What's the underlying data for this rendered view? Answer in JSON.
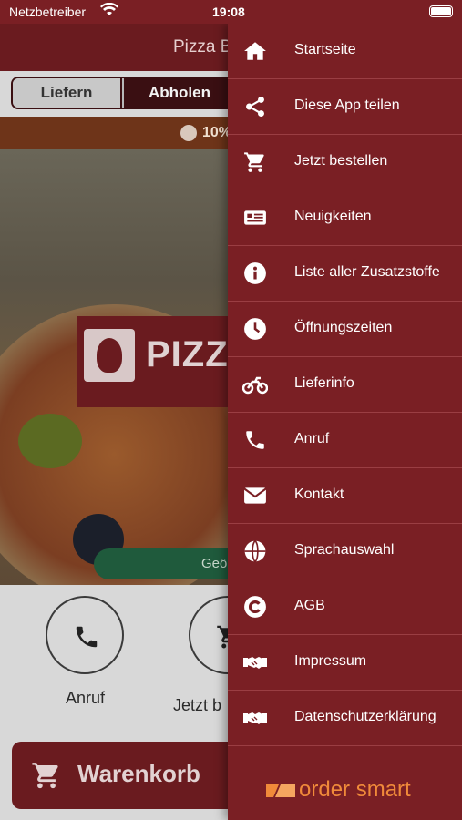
{
  "status_bar": {
    "carrier": "Netzbetreiber",
    "time": "19:08"
  },
  "header": {
    "title": "Pizza B"
  },
  "delivery_mode": {
    "options": [
      "Liefern",
      "Abholen"
    ],
    "selected": "Abholen"
  },
  "promo": {
    "text": "10%"
  },
  "hero": {
    "logo_text": "PIZZA",
    "open_status": "Geö"
  },
  "actions": [
    {
      "label": "Anruf",
      "icon": "phone-icon"
    },
    {
      "label": "Jetzt b",
      "icon": "cart-icon"
    }
  ],
  "cart": {
    "label": "Warenkorb"
  },
  "menu": {
    "items": [
      {
        "label": "Startseite",
        "icon": "home-icon"
      },
      {
        "label": "Diese App teilen",
        "icon": "share-icon"
      },
      {
        "label": "Jetzt bestellen",
        "icon": "cart-icon"
      },
      {
        "label": "Neuigkeiten",
        "icon": "newspaper-icon"
      },
      {
        "label": "Liste aller Zusatzstoffe",
        "icon": "info-icon"
      },
      {
        "label": "Öffnungszeiten",
        "icon": "clock-icon"
      },
      {
        "label": "Lieferinfo",
        "icon": "motorcycle-icon"
      },
      {
        "label": "Anruf",
        "icon": "phone-icon"
      },
      {
        "label": "Kontakt",
        "icon": "envelope-icon"
      },
      {
        "label": "Sprachauswahl",
        "icon": "globe-icon"
      },
      {
        "label": "AGB",
        "icon": "copyright-icon"
      },
      {
        "label": "Impressum",
        "icon": "handshake-icon"
      },
      {
        "label": "Datenschutzerklärung",
        "icon": "handshake-icon"
      }
    ]
  },
  "brand": {
    "text": "order smart"
  },
  "colors": {
    "drawer": "#7a1f24",
    "brand_orange": "#f08a3a",
    "promo": "#6e3419"
  }
}
